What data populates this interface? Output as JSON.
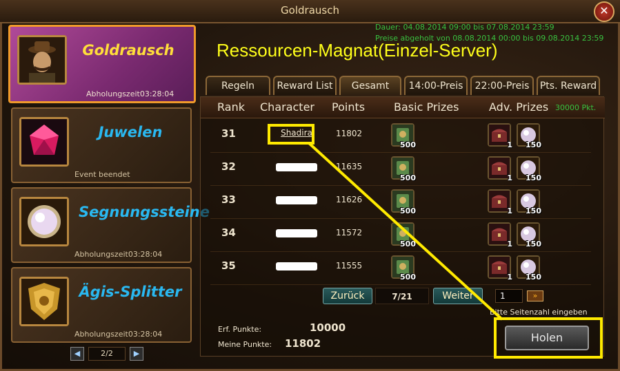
{
  "window": {
    "title": "Goldrausch"
  },
  "sidebar": {
    "events": [
      {
        "name": "Goldrausch",
        "status": "Abholungszeit03:28:04",
        "name_color": "#ffde3a",
        "active": true
      },
      {
        "name": "Juwelen",
        "status": "Event beendet",
        "name_color": "#2ab8f0"
      },
      {
        "name": "Segnungssteine",
        "status": "Abholungszeit03:28:04",
        "name_color": "#2ab8f0"
      },
      {
        "name": "Ägis-Splitter",
        "status": "Abholungszeit03:28:04",
        "name_color": "#2ab8f0"
      }
    ],
    "pager": {
      "label": "2/2",
      "prev_icon": "prev-arrow-icon",
      "next_icon": "next-arrow-icon"
    }
  },
  "header": {
    "date_line1": "Dauer: 04.08.2014 09:00 bis 07.08.2014 23:59",
    "date_line2": "Preise abgeholt von 08.08.2014 00:00 bis 09.08.2014 23:59",
    "title": "Ressourcen-Magnat(Einzel-Server)"
  },
  "tabs": [
    {
      "label": "Regeln"
    },
    {
      "label": "Reward List"
    },
    {
      "label": "Gesamt",
      "active": true
    },
    {
      "label": "14:00-Preis"
    },
    {
      "label": "22:00-Preis"
    },
    {
      "label": "Pts. Reward"
    }
  ],
  "table": {
    "headers": {
      "rank": "Rank",
      "character": "Character",
      "points": "Points",
      "basic": "Basic Prizes",
      "adv": "Adv. Prizes",
      "adv_note": "30000 Pkt."
    },
    "rows": [
      {
        "rank": "31",
        "name": "Shadira",
        "points": "11802",
        "basic_qty": "500",
        "chest_qty": "1",
        "orb_qty": "150"
      },
      {
        "rank": "32",
        "name": "",
        "points": "11635",
        "basic_qty": "500",
        "chest_qty": "1",
        "orb_qty": "150"
      },
      {
        "rank": "33",
        "name": "",
        "points": "11626",
        "basic_qty": "500",
        "chest_qty": "1",
        "orb_qty": "150"
      },
      {
        "rank": "34",
        "name": "",
        "points": "11572",
        "basic_qty": "500",
        "chest_qty": "1",
        "orb_qty": "150"
      },
      {
        "rank": "35",
        "name": "",
        "points": "11555",
        "basic_qty": "500",
        "chest_qty": "1",
        "orb_qty": "150"
      }
    ]
  },
  "pagination": {
    "back_label": "Zurück",
    "page": "7/21",
    "next_label": "Weiter",
    "input_value": "1",
    "go_icon": "double-chevron-right-icon",
    "hint": "Bitte Seitenzahl eingeben"
  },
  "points": {
    "required_label": "Erf. Punkte:",
    "required_value": "10000",
    "mine_label": "Meine Punkte:",
    "mine_value": "11802"
  },
  "claim_button": {
    "label": "Holen"
  },
  "annotation": {
    "color": "#ffea00"
  }
}
